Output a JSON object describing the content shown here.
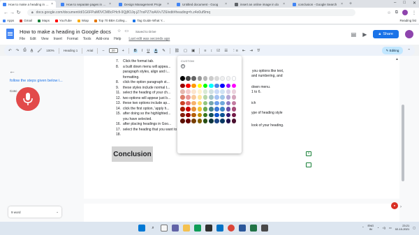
{
  "browser": {
    "tabs": [
      {
        "label": "How to make a heading in Goo",
        "active": true,
        "color": "#4285f4"
      },
      {
        "label": "How to separate pages in Goo",
        "active": false,
        "color": "#4285f4"
      },
      {
        "label": "Design Management Proje",
        "active": false,
        "color": "#4285f4"
      },
      {
        "label": "Untitled document - Goog",
        "active": false,
        "color": "#4285f4"
      },
      {
        "label": "insert an online image in do",
        "active": false,
        "color": "#5f6368"
      },
      {
        "label": "conclusion - Google Search",
        "active": false,
        "color": "#4285f4"
      }
    ],
    "new_tab": "+",
    "window_controls": [
      "–",
      "□",
      "✕"
    ],
    "url": "docs.google.com/document/d/1G6FPaM0VCM8cFHcfi-9Qj8OJq-jZ7nxPZ7ioAiVv7Z6/edit#heading=h.z4o0uf9mq",
    "bookmarks": [
      {
        "label": "Apps",
        "color": "#4285f4"
      },
      {
        "label": "Gmail",
        "color": "#d93025"
      },
      {
        "label": "Maps",
        "color": "#188038"
      },
      {
        "label": "YouTube",
        "color": "#ff0000"
      },
      {
        "label": "Wiap",
        "color": "#f9ab00"
      },
      {
        "label": "Top 70 BBA Colleg...",
        "color": "#e37400"
      },
      {
        "label": "Tag Guide What Y...",
        "color": "#1a73e8"
      }
    ],
    "reading_list": "Reading list"
  },
  "docs": {
    "title": "How to make a heading in Google docs",
    "save_status": "Saved to Drive",
    "menu": [
      "File",
      "Edit",
      "View",
      "Insert",
      "Format",
      "Tools",
      "Add-ons",
      "Help"
    ],
    "last_edit": "Last edit was seconds ago",
    "share_label": "Share",
    "toolbar": {
      "zoom": "100%",
      "style": "Heading 1",
      "font": "Arial",
      "size": "20",
      "mode": "Editing"
    }
  },
  "sidebar": {
    "outline_item": "follow the steps given below i...",
    "sub_item": "Conc",
    "word_count": "9 word"
  },
  "document": {
    "lines": [
      {
        "n": "7.",
        "text": "Click the format tab."
      },
      {
        "n": "8.",
        "text": "a built down menu will appea..."
      },
      {
        "n": "",
        "text": "paragraph styles, align and i..."
      },
      {
        "n": "",
        "text": "formatting."
      },
      {
        "n": "8.",
        "text": "click the option paragraph st..."
      },
      {
        "n": "9.",
        "text": "these styles include normal t..."
      },
      {
        "n": "11.",
        "text": "select the heading of your ch..."
      },
      {
        "n": "12.",
        "text": "two options will appear just b..."
      },
      {
        "n": "13.",
        "text": "these two options include ap..."
      },
      {
        "n": "14.",
        "text": "click the first option, 'apply h..."
      },
      {
        "n": "15.",
        "text": "after doing so the highlighted..."
      },
      {
        "n": "",
        "text": "you have selected."
      },
      {
        "n": "16.",
        "text": "after placing headings in Goo..."
      },
      {
        "n": "17.",
        "text": "select the heading that you want to customize."
      },
      {
        "n": "18.",
        "text": ""
      }
    ],
    "right_fragments": [
      "you options like text,",
      "and numbering, and",
      "down menu.",
      "1 to 6.",
      "ich",
      "ype of heading style",
      "look of your heading."
    ],
    "conclusion": "Conclusion"
  },
  "palette": {
    "custom_label": "CUSTOM",
    "rows": [
      [
        "#000000",
        "#434343",
        "#666666",
        "#999999",
        "#b7b7b7",
        "#cccccc",
        "#d9d9d9",
        "#efefef",
        "#f3f3f3",
        "#ffffff"
      ],
      [
        "#980000",
        "#ff0000",
        "#ff9900",
        "#ffff00",
        "#00ff00",
        "#00ffff",
        "#4a86e8",
        "#0000ff",
        "#9900ff",
        "#ff00ff"
      ],
      [
        "#e6b8af",
        "#f4cccc",
        "#fce5cd",
        "#fff2cc",
        "#d9ead3",
        "#d0e0e3",
        "#c9daf8",
        "#cfe2f3",
        "#d9d2e9",
        "#ead1dc"
      ],
      [
        "#dd7e6b",
        "#ea9999",
        "#f9cb9c",
        "#ffe599",
        "#b6d7a8",
        "#a2c4c9",
        "#a4c2f4",
        "#9fc5e8",
        "#b4a7d6",
        "#d5a6bd"
      ],
      [
        "#cc4125",
        "#e06666",
        "#f6b26b",
        "#ffd966",
        "#93c47d",
        "#76a5af",
        "#6d9eeb",
        "#6fa8dc",
        "#8e7cc3",
        "#c27ba0"
      ],
      [
        "#a61c00",
        "#cc0000",
        "#e69138",
        "#f1c232",
        "#6aa84f",
        "#45818e",
        "#3c78d8",
        "#3d85c6",
        "#674ea7",
        "#a64d79"
      ],
      [
        "#85200c",
        "#990000",
        "#b45f06",
        "#bf9000",
        "#38761d",
        "#134f5c",
        "#1155cc",
        "#0b5394",
        "#351c75",
        "#741b47"
      ],
      [
        "#5b0f00",
        "#660000",
        "#783f04",
        "#7f6000",
        "#274e13",
        "#0c343d",
        "#1c4587",
        "#073763",
        "#20124d",
        "#4c1130"
      ]
    ]
  },
  "taskbar": {
    "language": [
      "ENG",
      "IN"
    ],
    "time": "23:21",
    "date": "02-10-2021"
  }
}
